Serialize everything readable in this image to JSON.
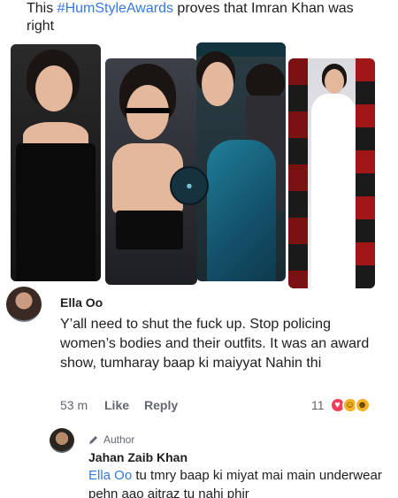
{
  "post": {
    "text_before": "This ",
    "hashtag": "#HumStyleAwards",
    "text_after": " proves that Imran Khan was right"
  },
  "comment": {
    "author": "Ella Oo",
    "body": "Y’all need to shut the fuck up. Stop policing women’s bodies and their outfits. It was an award show, tumharay baap ki maiyyat Nahin thi",
    "time": "53 m",
    "like_label": "Like",
    "reply_label": "Reply",
    "reaction_count": "11",
    "reactions": [
      "love-icon",
      "haha-icon",
      "care-icon"
    ]
  },
  "reply": {
    "badge": "Author",
    "author": "Jahan Zaib Khan",
    "mention": "Ella Oo",
    "body": " tu tmry baap ki miyat mai main underwear pehn aao aitraz tu nahi phir"
  },
  "colors": {
    "link": "#3578e5",
    "text": "#1c1e21",
    "muted": "#606770"
  }
}
